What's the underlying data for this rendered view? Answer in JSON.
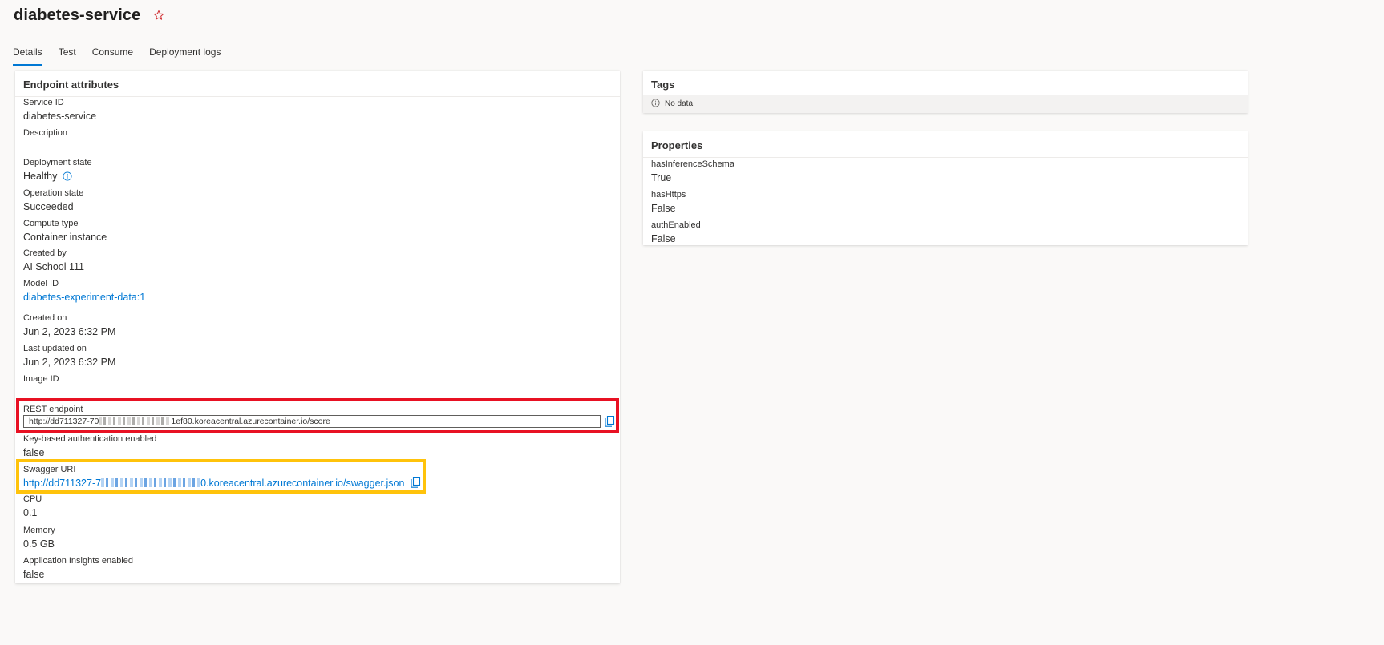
{
  "header": {
    "title": "diabetes-service"
  },
  "tabs": [
    {
      "label": "Details",
      "active": true
    },
    {
      "label": "Test"
    },
    {
      "label": "Consume"
    },
    {
      "label": "Deployment logs"
    }
  ],
  "endpoint_card": {
    "title": "Endpoint attributes",
    "service_id": {
      "label": "Service ID",
      "value": "diabetes-service"
    },
    "description": {
      "label": "Description",
      "value": "--"
    },
    "deployment_state": {
      "label": "Deployment state",
      "value": "Healthy"
    },
    "operation_state": {
      "label": "Operation state",
      "value": "Succeeded"
    },
    "compute_type": {
      "label": "Compute type",
      "value": "Container instance"
    },
    "created_by": {
      "label": "Created by",
      "value": "AI School 111"
    },
    "model_id": {
      "label": "Model ID",
      "value": "diabetes-experiment-data:1"
    },
    "created_on": {
      "label": "Created on",
      "value": "Jun 2, 2023 6:32 PM"
    },
    "last_updated": {
      "label": "Last updated on",
      "value": "Jun 2, 2023 6:32 PM"
    },
    "image_id": {
      "label": "Image ID",
      "value": "--"
    },
    "rest_endpoint": {
      "label": "REST endpoint",
      "value_prefix": "http://dd711327-70",
      "value_suffix": "1ef80.koreacentral.azurecontainer.io/score"
    },
    "key_auth": {
      "label": "Key-based authentication enabled",
      "value": "false"
    },
    "swagger": {
      "label": "Swagger URI",
      "value_prefix": "http://dd711327-7",
      "value_suffix": "0.koreacentral.azurecontainer.io/swagger.json"
    },
    "cpu": {
      "label": "CPU",
      "value": "0.1"
    },
    "memory": {
      "label": "Memory",
      "value": "0.5 GB"
    },
    "app_insights": {
      "label": "Application Insights enabled",
      "value": "false"
    }
  },
  "tags_card": {
    "title": "Tags",
    "empty_text": "No data"
  },
  "properties_card": {
    "title": "Properties",
    "items": [
      {
        "label": "hasInferenceSchema",
        "value": "True"
      },
      {
        "label": "hasHttps",
        "value": "False"
      },
      {
        "label": "authEnabled",
        "value": "False"
      }
    ]
  },
  "colors": {
    "accent": "#0078d4",
    "highlight_red": "#e81123",
    "highlight_yellow": "#ffc30b",
    "star": "#d13438"
  }
}
